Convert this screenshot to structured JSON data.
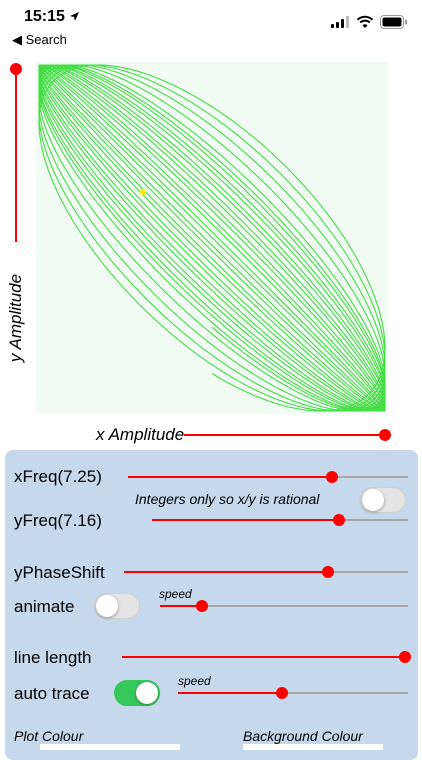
{
  "status_bar": {
    "time": "15:15",
    "back_label": "◀ Search"
  },
  "plot": {
    "x_axis_label": "x Amplitude",
    "y_axis_label": "y Amplitude",
    "curve_color": "#44dd44",
    "background_color": "#f1fbf3",
    "marker_color": "#ffee00",
    "x_amplitude": 1.0,
    "y_amplitude": 1.0
  },
  "controls": {
    "xfreq": {
      "label": "xFreq(7.25)",
      "value": 0.73
    },
    "integers_note": "Integers only so x/y is rational",
    "integers_only": false,
    "yfreq": {
      "label": "yFreq(7.16)",
      "value": 0.73
    },
    "yphase": {
      "label": "yPhaseShift",
      "value": 0.72
    },
    "animate": {
      "label": "animate",
      "on": false,
      "speed_label": "speed",
      "speed_value": 0.17
    },
    "line_length": {
      "label": "line length",
      "value": 1.0
    },
    "auto_trace": {
      "label": "auto trace",
      "on": true,
      "speed_label": "speed",
      "speed_value": 0.45
    },
    "plot_colour_label": "Plot Colour",
    "background_colour_label": "Background Colour"
  },
  "accent_color": "#ff0000"
}
